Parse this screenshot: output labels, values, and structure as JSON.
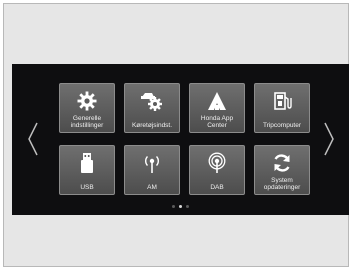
{
  "tiles": [
    {
      "label": "Generelle\nindstillinger",
      "icon": "gear-icon"
    },
    {
      "label": "Køretøjsindst.",
      "icon": "car-gear-icon"
    },
    {
      "label": "Honda App\nCenter",
      "icon": "app-center-icon"
    },
    {
      "label": "Tripcomputer",
      "icon": "fuel-pump-icon"
    },
    {
      "label": "USB",
      "icon": "usb-icon"
    },
    {
      "label": "AM",
      "icon": "am-radio-icon"
    },
    {
      "label": "DAB",
      "icon": "dab-radio-icon"
    },
    {
      "label": "System\nopdateringer",
      "icon": "refresh-icon"
    }
  ],
  "pagination": {
    "total": 3,
    "active": 1
  }
}
